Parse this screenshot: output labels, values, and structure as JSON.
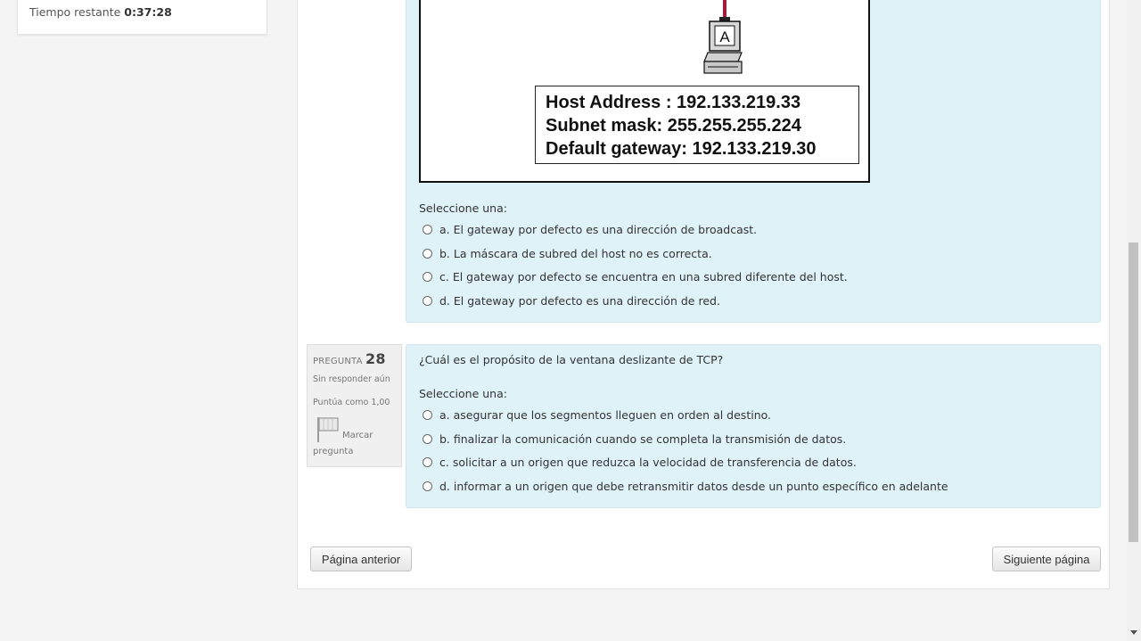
{
  "timer": {
    "label": "Tiempo restante",
    "value": "0:37:28"
  },
  "q27": {
    "diagram": {
      "host_label": "A",
      "host_address": "Host Address : 192.133.219.33",
      "subnet_mask": "Subnet mask: 255.255.255.224",
      "default_gateway": "Default gateway: 192.133.219.30"
    },
    "prompt": "Seleccione una:",
    "options": [
      "a. El gateway por defecto es una dirección de broadcast.",
      "b. La máscara de subred del host no es correcta.",
      "c. El gateway por defecto se encuentra en una subred diferente del host.",
      "d. El gateway por defecto es una dirección de red."
    ]
  },
  "q28": {
    "info": {
      "label": "PREGUNTA",
      "number": "28",
      "state": "Sin responder aún",
      "grade": "Puntúa como 1,00",
      "flag_line1": "Marcar",
      "flag_line2": "pregunta"
    },
    "question": "¿Cuál es el propósito de la ventana deslizante de TCP?",
    "prompt": "Seleccione una:",
    "options": [
      "a. asegurar que los segmentos lleguen en orden al destino.",
      "b. finalizar la comunicación cuando se completa la transmisión de datos.",
      "c. solicitar a un origen que reduzca la velocidad de transferencia de datos.",
      "d. informar a un origen que debe retransmitir datos desde un punto específico en adelante"
    ]
  },
  "nav": {
    "prev": "Página anterior",
    "next": "Siguiente página"
  }
}
